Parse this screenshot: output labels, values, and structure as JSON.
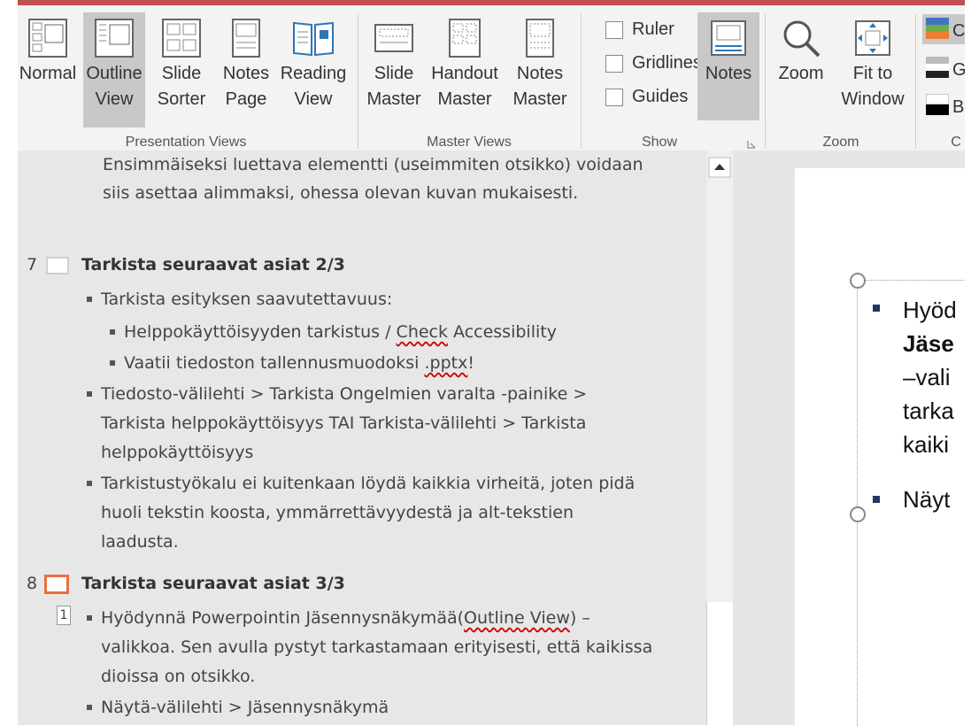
{
  "ribbon": {
    "views": [
      {
        "label1": "Normal",
        "label2": "",
        "active": false
      },
      {
        "label1": "Outline",
        "label2": "View",
        "active": true
      },
      {
        "label1": "Slide",
        "label2": "Sorter",
        "active": false
      },
      {
        "label1": "Notes",
        "label2": "Page",
        "active": false
      },
      {
        "label1": "Reading",
        "label2": "View",
        "active": false
      }
    ],
    "masters": [
      {
        "label1": "Slide",
        "label2": "Master"
      },
      {
        "label1": "Handout",
        "label2": "Master"
      },
      {
        "label1": "Notes",
        "label2": "Master"
      }
    ],
    "show": {
      "ruler": "Ruler",
      "gridlines": "Gridlines",
      "guides": "Guides",
      "notes": "Notes"
    },
    "zoom": {
      "zoom": "Zoom",
      "fit1": "Fit to",
      "fit2": "Window"
    },
    "color": {
      "c1": "C",
      "c2": "G",
      "c3": "B",
      "label": "C"
    },
    "groups": {
      "presentation": "Presentation Views",
      "master": "Master Views",
      "show": "Show",
      "zoom": "Zoom"
    }
  },
  "outline": {
    "intro1": "Ensimmäiseksi luettava elementti (useimmiten otsikko) voidaan",
    "intro2": "siis asettaa alimmaksi, ohessa olevan kuvan mukaisesti.",
    "slide7": {
      "num": "7",
      "title": "Tarkista seuraavat asiat 2/3",
      "b1": "Tarkista esityksen saavutettavuus:",
      "b1a_pre": "Helppokäyttöisyyden tarkistus / ",
      "b1a_link": "Check",
      "b1a_post": " Accessibility",
      "b1b_pre": "Vaatii tiedoston tallennusmuodoksi ",
      "b1b_link": ".pptx",
      "b1b_post": "!",
      "b2_1": "Tiedosto-välilehti > Tarkista Ongelmien varalta -painike >",
      "b2_2": "Tarkista helppokäyttöisyys TAI Tarkista-välilehti > Tarkista",
      "b2_3": "helppokäyttöisyys",
      "b3_1": "Tarkistustyökalu ei kuitenkaan löydä kaikkia virheitä, joten pidä",
      "b3_2": "huoli tekstin koosta, ymmärrettävyydestä ja alt-tekstien",
      "b3_3": "laadusta."
    },
    "slide8": {
      "num": "8",
      "title": "Tarkista seuraavat asiat 3/3",
      "level": "1",
      "b1_pre": "Hyödynnä Powerpointin Jäsennysnäkymää(",
      "b1_link": "Outline View",
      "b1_post": ") –",
      "b1_2": "valikkoa. Sen avulla pystyt tarkastamaan erityisesti, että kaikissa",
      "b1_3": "dioissa on otsikko.",
      "b2": "Näytä-välilehti > Jäsennysnäkymä"
    }
  },
  "slide": {
    "l1": "Hyöd",
    "l2": "Jäse",
    "l3": "–vali",
    "l4": "tarka",
    "l5": "kaiki",
    "l6": "Näyt"
  },
  "colors": {
    "accent": "#c0504d",
    "selected_slide": "#e9713e",
    "bullet_blue": "#1f3864"
  }
}
